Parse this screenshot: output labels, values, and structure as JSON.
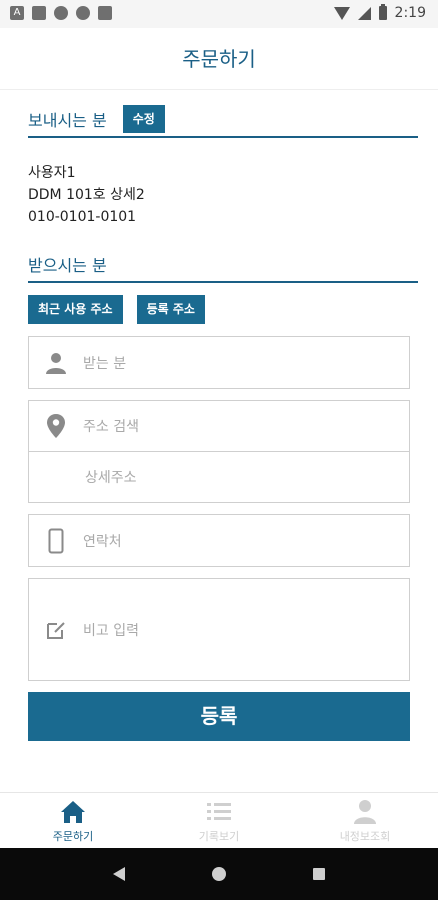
{
  "status_bar": {
    "time": "2:19",
    "icons": [
      "a-icon",
      "gmail-icon",
      "share-icon",
      "circle-icon",
      "sdcard-icon",
      "wifi-icon",
      "signal-icon",
      "battery-icon"
    ]
  },
  "header": {
    "title": "주문하기"
  },
  "sender": {
    "title": "보내시는 분",
    "edit_label": "수정",
    "name": "사용자1",
    "address": "DDM 101호 상세2",
    "phone": "010-0101-0101"
  },
  "receiver": {
    "title": "받으시는 분",
    "recent_address_label": "최근 사용 주소",
    "registered_address_label": "등록 주소",
    "name_placeholder": "받는 분",
    "address_search_placeholder": "주소 검색",
    "address_detail_placeholder": "상세주소",
    "phone_placeholder": "연락처",
    "memo_placeholder": "비고 입력"
  },
  "submit_label": "등록",
  "tabs": [
    {
      "label": "주문하기",
      "icon": "home-icon",
      "active": true
    },
    {
      "label": "기록보기",
      "icon": "list-icon",
      "active": false
    },
    {
      "label": "내정보조회",
      "icon": "user-icon",
      "active": false
    }
  ],
  "colors": {
    "accent": "#1a6a90",
    "title": "#1a5f86",
    "placeholder": "#a9a9a9"
  }
}
